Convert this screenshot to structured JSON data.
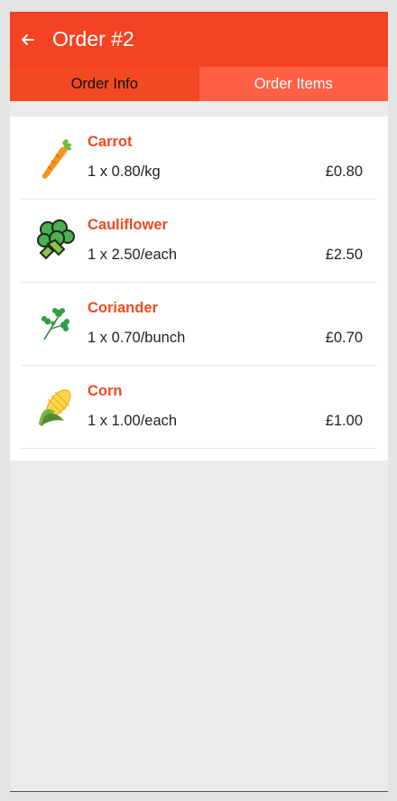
{
  "header": {
    "title": "Order #2"
  },
  "tabs": [
    {
      "label": "Order Info"
    },
    {
      "label": "Order Items"
    }
  ],
  "items": [
    {
      "name": "Carrot",
      "qty": "1 x 0.80/kg",
      "price": "£0.80",
      "icon": "carrot-icon"
    },
    {
      "name": "Cauliflower",
      "qty": "1 x 2.50/each",
      "price": "£2.50",
      "icon": "broccoli-icon"
    },
    {
      "name": "Coriander",
      "qty": "1 x 0.70/bunch",
      "price": "£0.70",
      "icon": "herb-icon"
    },
    {
      "name": "Corn",
      "qty": "1 x 1.00/each",
      "price": "£1.00",
      "icon": "corn-icon"
    }
  ],
  "colors": {
    "primary": "#f44323",
    "accent": "#f0491f",
    "tab_selected": "#fe6045"
  }
}
